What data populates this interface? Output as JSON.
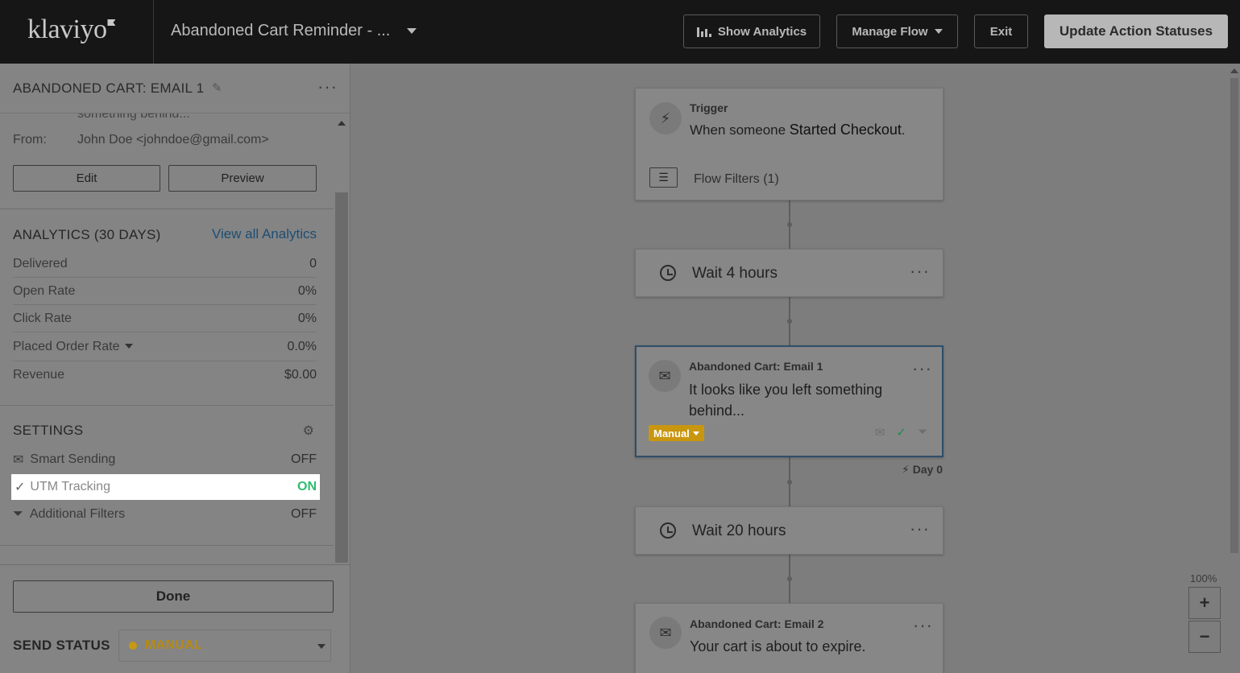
{
  "topbar": {
    "logo": "klaviyo",
    "flow_name": "Abandoned Cart Reminder - ...",
    "show_analytics": "Show Analytics",
    "manage_flow": "Manage Flow",
    "exit": "Exit",
    "update_statuses": "Update Action Statuses"
  },
  "panel": {
    "title": "ABANDONED CART: EMAIL 1",
    "cut_preview": "something behind...",
    "from_label": "From:",
    "from_value": "John Doe <johndoe@gmail.com>",
    "edit_label": "Edit",
    "preview_label": "Preview",
    "analytics": {
      "title": "ANALYTICS (30 DAYS)",
      "view_all": "View all Analytics",
      "rows": [
        {
          "label": "Delivered",
          "value": "0"
        },
        {
          "label": "Open Rate",
          "value": "0%"
        },
        {
          "label": "Click Rate",
          "value": "0%"
        },
        {
          "label": "Placed Order Rate",
          "value": "0.0%"
        },
        {
          "label": "Revenue",
          "value": "$0.00"
        }
      ]
    },
    "settings": {
      "title": "SETTINGS",
      "rows": [
        {
          "label": "Smart Sending",
          "value": "OFF"
        },
        {
          "label": "UTM Tracking",
          "value": "ON"
        },
        {
          "label": "Additional Filters",
          "value": "OFF"
        }
      ]
    },
    "done_label": "Done",
    "send_status_label": "SEND STATUS",
    "send_status_value": "MANUAL"
  },
  "canvas": {
    "trigger": {
      "label": "Trigger",
      "text_prefix": "When someone ",
      "text_metric": "Started Checkout",
      "text_suffix": ".",
      "filters": "Flow Filters (1)"
    },
    "wait1": "Wait 4 hours",
    "email1": {
      "label": "Abandoned Cart: Email 1",
      "subject": "It looks like you left something behind...",
      "badge": "Manual"
    },
    "day_label": "Day 0",
    "wait2": "Wait 20 hours",
    "email2": {
      "label": "Abandoned Cart: Email 2",
      "subject": "Your cart is about to expire."
    },
    "zoom_level": "100%",
    "zoom_in": "+",
    "zoom_out": "−"
  },
  "colors": {
    "on_green": "#2ebc6e",
    "manual_gold": "#c9960f",
    "link_blue": "#1d4e73"
  }
}
